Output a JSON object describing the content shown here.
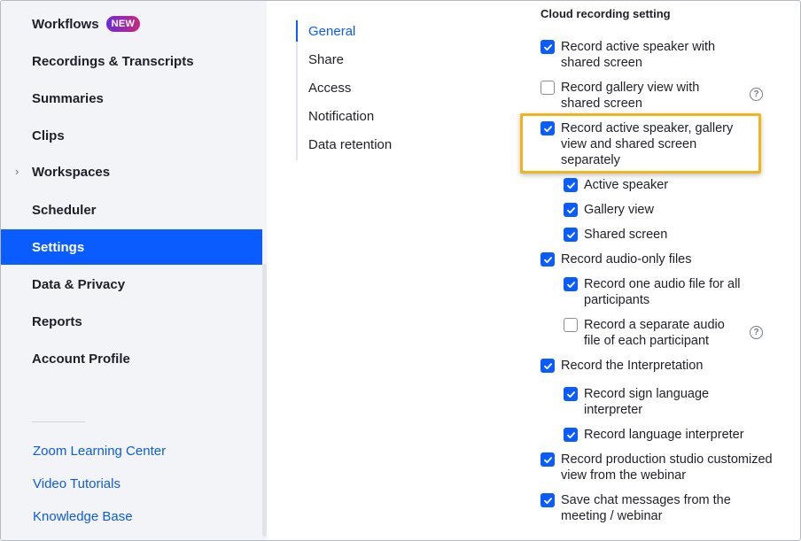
{
  "sidebar": {
    "items": [
      {
        "label": "Workflows",
        "badge": "NEW"
      },
      {
        "label": "Recordings & Transcripts"
      },
      {
        "label": "Summaries"
      },
      {
        "label": "Clips"
      },
      {
        "label": "Workspaces",
        "chevron": "›"
      },
      {
        "label": "Scheduler"
      },
      {
        "label": "Settings",
        "active": true
      },
      {
        "label": "Data & Privacy"
      },
      {
        "label": "Reports"
      },
      {
        "label": "Account Profile"
      }
    ],
    "links": [
      {
        "label": "Zoom Learning Center"
      },
      {
        "label": "Video Tutorials"
      },
      {
        "label": "Knowledge Base"
      }
    ]
  },
  "sub_nav": {
    "items": [
      "General",
      "Share",
      "Access",
      "Notification",
      "Data retention"
    ],
    "active": "General"
  },
  "settings": {
    "title": "Cloud recording setting",
    "options": [
      {
        "label": "Record active speaker with shared screen",
        "checked": true
      },
      {
        "label": "Record gallery view with shared screen",
        "checked": false
      },
      {
        "label": "Record active speaker, gallery view and shared screen separately",
        "checked": true
      },
      {
        "label": "Active speaker",
        "checked": true
      },
      {
        "label": "Gallery view",
        "checked": true
      },
      {
        "label": "Shared screen",
        "checked": true
      },
      {
        "label": "Record audio-only files",
        "checked": true
      },
      {
        "label": "Record one audio file for all participants",
        "checked": true
      },
      {
        "label": "Record a separate audio file of each participant",
        "checked": false
      },
      {
        "label": "Record the Interpretation",
        "checked": true
      },
      {
        "label": "Record sign language interpreter",
        "checked": true
      },
      {
        "label": "Record language interpreter",
        "checked": true
      },
      {
        "label": "Record production studio customized view from the webinar",
        "checked": true
      },
      {
        "label": "Save chat messages from the meeting / webinar",
        "checked": true
      }
    ],
    "help_glyph": "?"
  },
  "colors": {
    "accent": "#0b5cff",
    "sidebar_bg": "#f3f4f7",
    "highlight": "#f0b41c",
    "link": "#0e5cdd"
  }
}
